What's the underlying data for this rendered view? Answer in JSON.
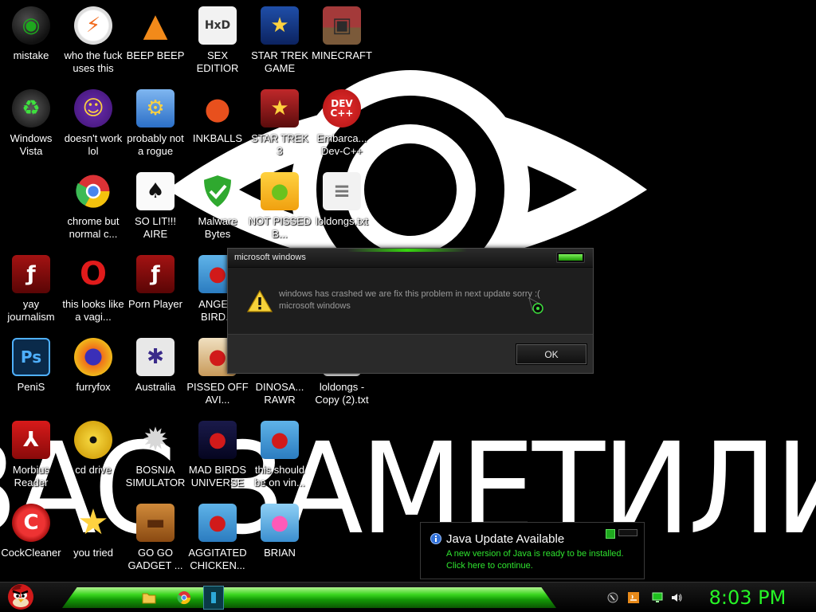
{
  "wallpaper": {
    "text": "ВАС ЗАМЕТИЛИ"
  },
  "desktop_icons": [
    {
      "label": "mistake",
      "icon": "green-orb-icon"
    },
    {
      "label": "who the fuck uses this",
      "icon": "lightning-icon"
    },
    {
      "label": "BEEP BEEP",
      "icon": "vlc-cone-icon"
    },
    {
      "label": "SEX EDITIOR",
      "icon": "hxd-icon"
    },
    {
      "label": "STAR TREK GAME",
      "icon": "star-wars-icon"
    },
    {
      "label": "MINECRAFT",
      "icon": "minecraft-icon"
    },
    {
      "label": "Windows Vista",
      "icon": "recycle-bin-icon"
    },
    {
      "label": "doesn't work lol",
      "icon": "yahoo-messenger-icon"
    },
    {
      "label": "probably not a rogue",
      "icon": "gears-monitor-icon"
    },
    {
      "label": "INKBALLS",
      "icon": "inkball-icon"
    },
    {
      "label": "STAR TREK 3",
      "icon": "star-wars-3-icon"
    },
    {
      "label": "Embarca... Dev-C++",
      "icon": "dev-cpp-icon"
    },
    {
      "label": "chrome but normal c...",
      "icon": "chrome-icon"
    },
    {
      "label": "SO LIT!!! AIRE",
      "icon": "solitaire-icon"
    },
    {
      "label": "Malware Bytes",
      "icon": "shield-icon"
    },
    {
      "label": "NOT PISSED B...",
      "icon": "bad-piggies-icon"
    },
    {
      "label": "loldongs.txt",
      "icon": "text-file-icon"
    },
    {
      "label": "yay journalism",
      "icon": "flash-icon"
    },
    {
      "label": "this looks like a vagi...",
      "icon": "opera-icon"
    },
    {
      "label": "Porn Player",
      "icon": "flash-player-icon"
    },
    {
      "label": "ANGE... BIRD...",
      "icon": "angry-birds-icon"
    },
    {
      "label": "PeniS",
      "icon": "photoshop-icon"
    },
    {
      "label": "furryfox",
      "icon": "firefox-icon"
    },
    {
      "label": "Australia",
      "icon": "spider-solitaire-icon"
    },
    {
      "label": "PISSED OFF AVI...",
      "icon": "angry-birds-seasons-icon"
    },
    {
      "label": "DINOSA... RAWR",
      "icon": "dinosaur-icon"
    },
    {
      "label": "loldongs - Copy (2).txt",
      "icon": "text-file-icon"
    },
    {
      "label": "Morbius Reader",
      "icon": "acrobat-icon"
    },
    {
      "label": "cd drive",
      "icon": "cd-icon"
    },
    {
      "label": "BOSNIA SIMULATOR",
      "icon": "minesweeper-icon"
    },
    {
      "label": "MAD BIRDS UNIVERSE",
      "icon": "angry-birds-space-icon"
    },
    {
      "label": "this should be on vin...",
      "icon": "angry-birds-icon"
    },
    {
      "label": "CockCleaner",
      "icon": "ccleaner-icon"
    },
    {
      "label": "you tried",
      "icon": "star-icon"
    },
    {
      "label": "GO GO GADGET ...",
      "icon": "briefcase-icon"
    },
    {
      "label": "AGGITATED CHICKEN...",
      "icon": "angry-birds-rio-icon"
    },
    {
      "label": "BRIAN",
      "icon": "angry-birds-stella-icon"
    }
  ],
  "dialog": {
    "title": "microsoft windows",
    "message_line1": "windows has crashed we are fix this problem in next update sorry :(",
    "message_line2": "microsoft windows",
    "ok_label": "OK",
    "icon": "warning-icon"
  },
  "balloon": {
    "title": "Java Update Available",
    "line1": "A new version of Java is ready to be installed.",
    "line2": "Click here to continue.",
    "icon": "info-icon"
  },
  "taskbar": {
    "start_icon": "angry-bird-start-icon",
    "pinned": [
      "folder-icon",
      "chrome-icon",
      "app-window-icon"
    ],
    "tray": [
      "task-manager-icon",
      "java-icon",
      "network-icon",
      "volume-icon"
    ],
    "clock": "8:03 PM"
  },
  "colors": {
    "accent_green": "#26f526",
    "dialog_bg": "#1e1e1e",
    "balloon_text": "#2fe42f"
  }
}
